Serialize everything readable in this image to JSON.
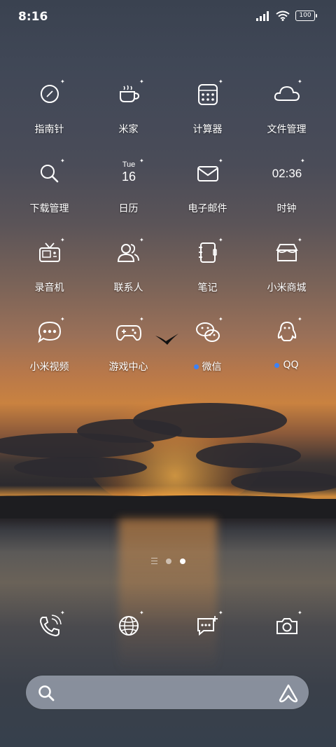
{
  "status_bar": {
    "time": "8:16",
    "battery": "100"
  },
  "apps": [
    {
      "label": "指南针",
      "icon": "compass-icon",
      "dot": false
    },
    {
      "label": "米家",
      "icon": "cup-icon",
      "dot": false
    },
    {
      "label": "计算器",
      "icon": "calculator-icon",
      "dot": false
    },
    {
      "label": "文件管理",
      "icon": "cloud-icon",
      "dot": false
    },
    {
      "label": "下载管理",
      "icon": "magnifier-icon",
      "dot": false
    },
    {
      "label": "日历",
      "icon": "calendar-icon",
      "dot": false
    },
    {
      "label": "电子邮件",
      "icon": "envelope-icon",
      "dot": false
    },
    {
      "label": "时钟",
      "icon": "clock-icon",
      "dot": false
    },
    {
      "label": "录音机",
      "icon": "radio-icon",
      "dot": false
    },
    {
      "label": "联系人",
      "icon": "contacts-icon",
      "dot": false
    },
    {
      "label": "笔记",
      "icon": "notebook-icon",
      "dot": false
    },
    {
      "label": "小米商城",
      "icon": "store-icon",
      "dot": false
    },
    {
      "label": "小米视频",
      "icon": "chat-bubble-icon",
      "dot": false
    },
    {
      "label": "游戏中心",
      "icon": "gamepad-icon",
      "dot": false
    },
    {
      "label": "微信",
      "icon": "wechat-icon",
      "dot": true
    },
    {
      "label": "QQ",
      "icon": "qq-penguin-icon",
      "dot": true
    }
  ],
  "calendar_icon": {
    "weekday": "Tue",
    "day": "16"
  },
  "clock_icon": {
    "time": "02:36"
  },
  "pager": {
    "pages": 2,
    "current": 2
  },
  "dock": [
    {
      "icon": "phone-icon"
    },
    {
      "icon": "browser-globe-icon"
    },
    {
      "icon": "messages-icon"
    },
    {
      "icon": "camera-icon"
    }
  ],
  "colors": {
    "dot_blue": "#3b82f6",
    "search_bg": "#969eaa"
  }
}
